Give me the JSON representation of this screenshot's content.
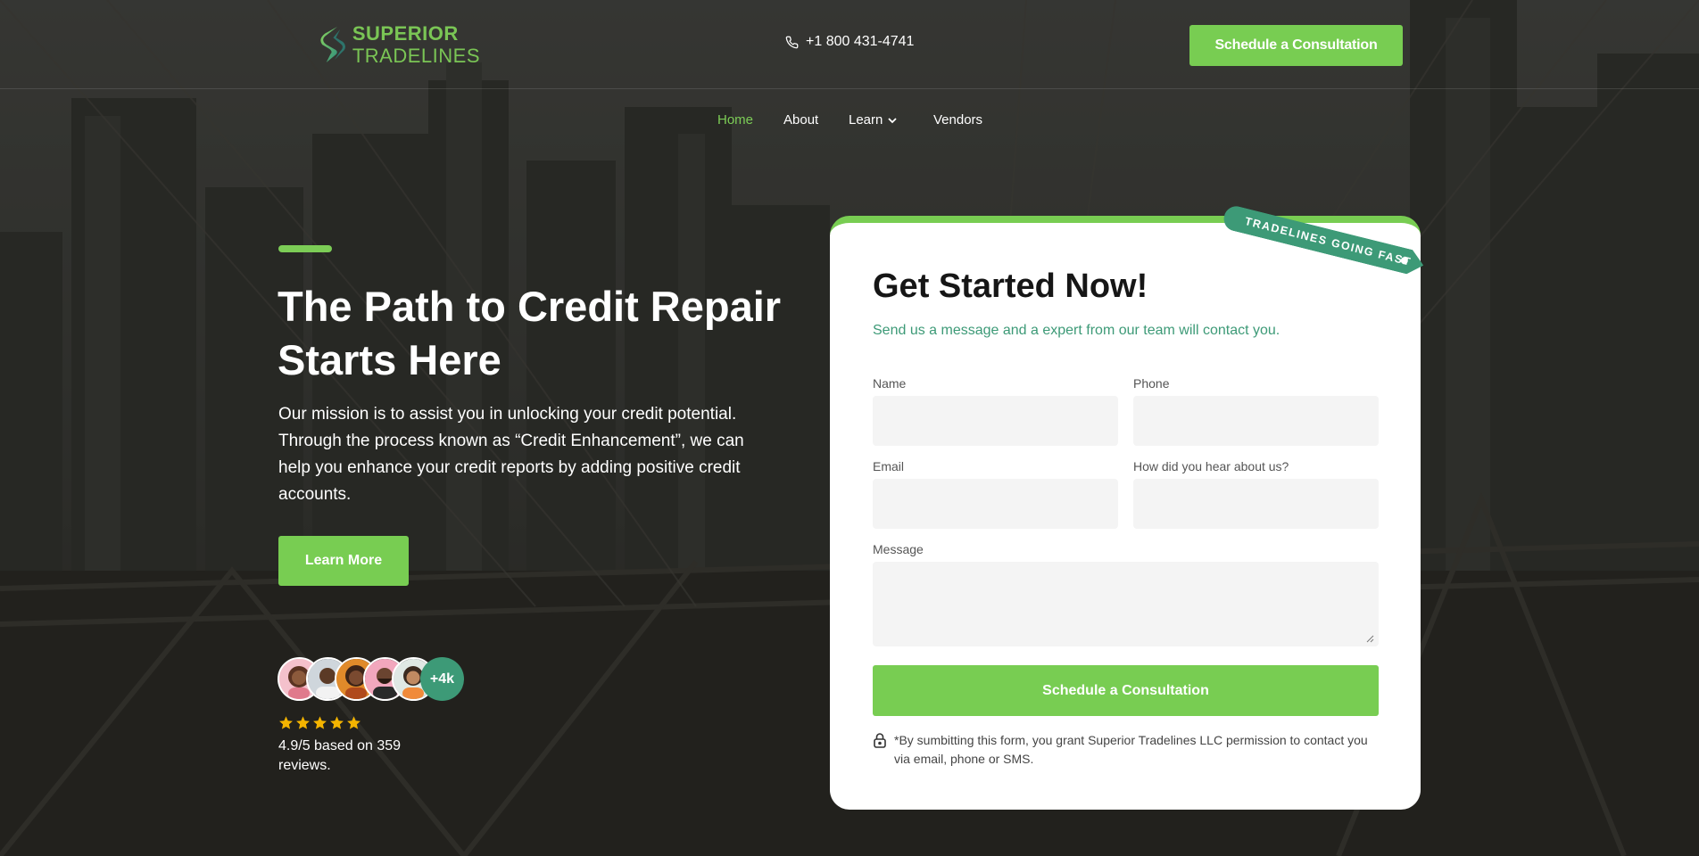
{
  "brand": {
    "line1": "SUPERIOR",
    "line2": "TRADELINES",
    "color": "#7ac555"
  },
  "header": {
    "phone_icon": "phone-icon",
    "phone": "+1 800 431-4741",
    "cta_label": "Schedule a Consultation"
  },
  "nav": {
    "items": [
      {
        "label": "Home",
        "active": true
      },
      {
        "label": "About"
      },
      {
        "label": "Learn",
        "has_dropdown": true,
        "icon": "chevron-down-icon"
      },
      {
        "label": "Vendors"
      }
    ]
  },
  "hero": {
    "title": "The Path to Credit Repair Starts Here",
    "text": "Our mission is to assist you in unlocking your credit potential. Through the process known as “Credit Enhancement”, we can help you enhance your credit reports by adding positive credit accounts.",
    "button_label": "Learn More",
    "avatars_more": "+4k",
    "stars": 5,
    "rating_text": "4.9/5 based on 359 reviews."
  },
  "form": {
    "ribbon": "TRADELINES GOING FAST",
    "title": "Get Started Now!",
    "subtitle": "Send us a message and a expert from our team will contact you.",
    "fields": {
      "name_label": "Name",
      "name_value": "",
      "phone_label": "Phone",
      "phone_value": "",
      "email_label": "Email",
      "email_value": "",
      "source_label": "How did you hear about us?",
      "source_value": "",
      "message_label": "Message",
      "message_value": ""
    },
    "submit_label": "Schedule a Consultation",
    "disclaimer_icon": "lock-icon",
    "disclaimer": "*By sumbitting this form, you grant Superior Tradelines LLC permission to contact you via email, phone or SMS."
  },
  "colors": {
    "accent_green": "#78cd52",
    "teal": "#3d9a77",
    "star": "#f4b400"
  }
}
